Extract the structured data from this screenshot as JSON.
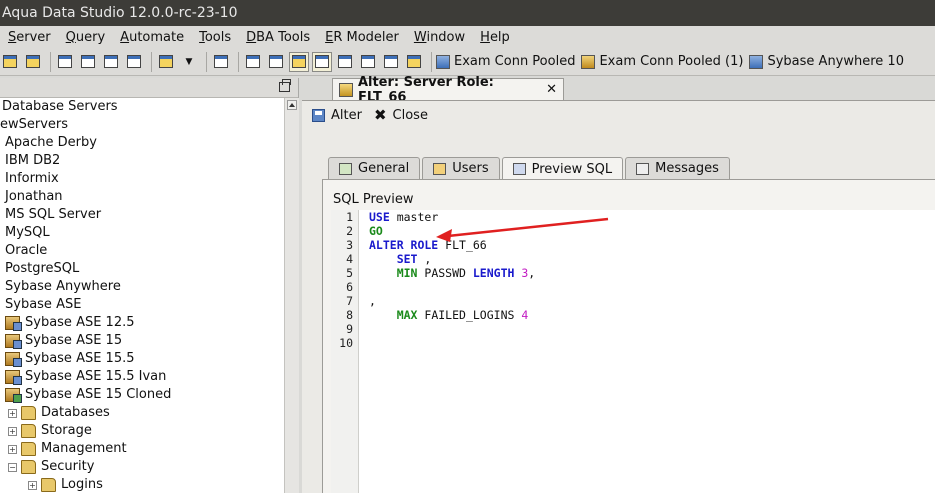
{
  "window": {
    "title": "Aqua Data Studio 12.0.0-rc-23-10"
  },
  "menu": [
    {
      "mnemonic": "S",
      "rest": "erver"
    },
    {
      "mnemonic": "Q",
      "rest": "uery"
    },
    {
      "mnemonic": "A",
      "rest": "utomate"
    },
    {
      "mnemonic": "T",
      "rest": "ools"
    },
    {
      "mnemonic": "D",
      "rest": "BA Tools"
    },
    {
      "mnemonic": "E",
      "rest": "R Modeler"
    },
    {
      "mnemonic": "W",
      "rest": "indow"
    },
    {
      "mnemonic": "H",
      "rest": "elp"
    }
  ],
  "toolbar": {
    "connections": [
      "Exam Conn Pooled",
      "Exam Conn Pooled (1)",
      "Sybase Anywhere 10"
    ]
  },
  "tree": {
    "items": [
      {
        "label": "Database Servers"
      },
      {
        "label": "ewServers"
      },
      {
        "label": "Apache Derby"
      },
      {
        "label": "IBM DB2"
      },
      {
        "label": "Informix"
      },
      {
        "label": "Jonathan"
      },
      {
        "label": "MS SQL Server"
      },
      {
        "label": "MySQL"
      },
      {
        "label": "Oracle"
      },
      {
        "label": "PostgreSQL"
      },
      {
        "label": "Sybase Anywhere"
      },
      {
        "label": "Sybase ASE"
      },
      {
        "label": "Sybase ASE 12.5"
      },
      {
        "label": "Sybase ASE 15"
      },
      {
        "label": "Sybase ASE 15.5"
      },
      {
        "label": "Sybase ASE 15.5 Ivan"
      },
      {
        "label": "Sybase ASE 15 Cloned"
      },
      {
        "label": "Databases"
      },
      {
        "label": "Storage"
      },
      {
        "label": "Management"
      },
      {
        "label": "Security"
      },
      {
        "label": "Logins"
      }
    ]
  },
  "document_tab": {
    "title": "Alter: Server Role: FLT_66"
  },
  "actions": {
    "alter": "Alter",
    "close": "Close"
  },
  "subtabs": [
    "General",
    "Users",
    "Preview SQL",
    "Messages"
  ],
  "preview": {
    "label": "SQL Preview",
    "line_numbers": [
      "1",
      "2",
      "3",
      "4",
      "5",
      "6",
      "7",
      "8",
      "9",
      "10"
    ],
    "code": {
      "l1_kw": "USE",
      "l1_rest": " master",
      "l2_kw": "GO",
      "l3_kw": "ALTER ROLE",
      "l3_rest": " FLT_66",
      "l4_kw": "SET",
      "l4_rest": " ,",
      "l5_kw": "MIN",
      "l5_mid": " PASSWD ",
      "l5_kw2": "LENGTH",
      "l5_num": " 3",
      "l5_rest": ",",
      "l7_rest": ",",
      "l8_kw": "MAX",
      "l8_mid": " FAILED_LOGINS ",
      "l8_num": "4"
    }
  },
  "colors": {
    "keyword": "#1a1acc",
    "keyword2": "#1a8a1a",
    "number": "#c21ac2",
    "annotation_arrow": "#e02020"
  }
}
